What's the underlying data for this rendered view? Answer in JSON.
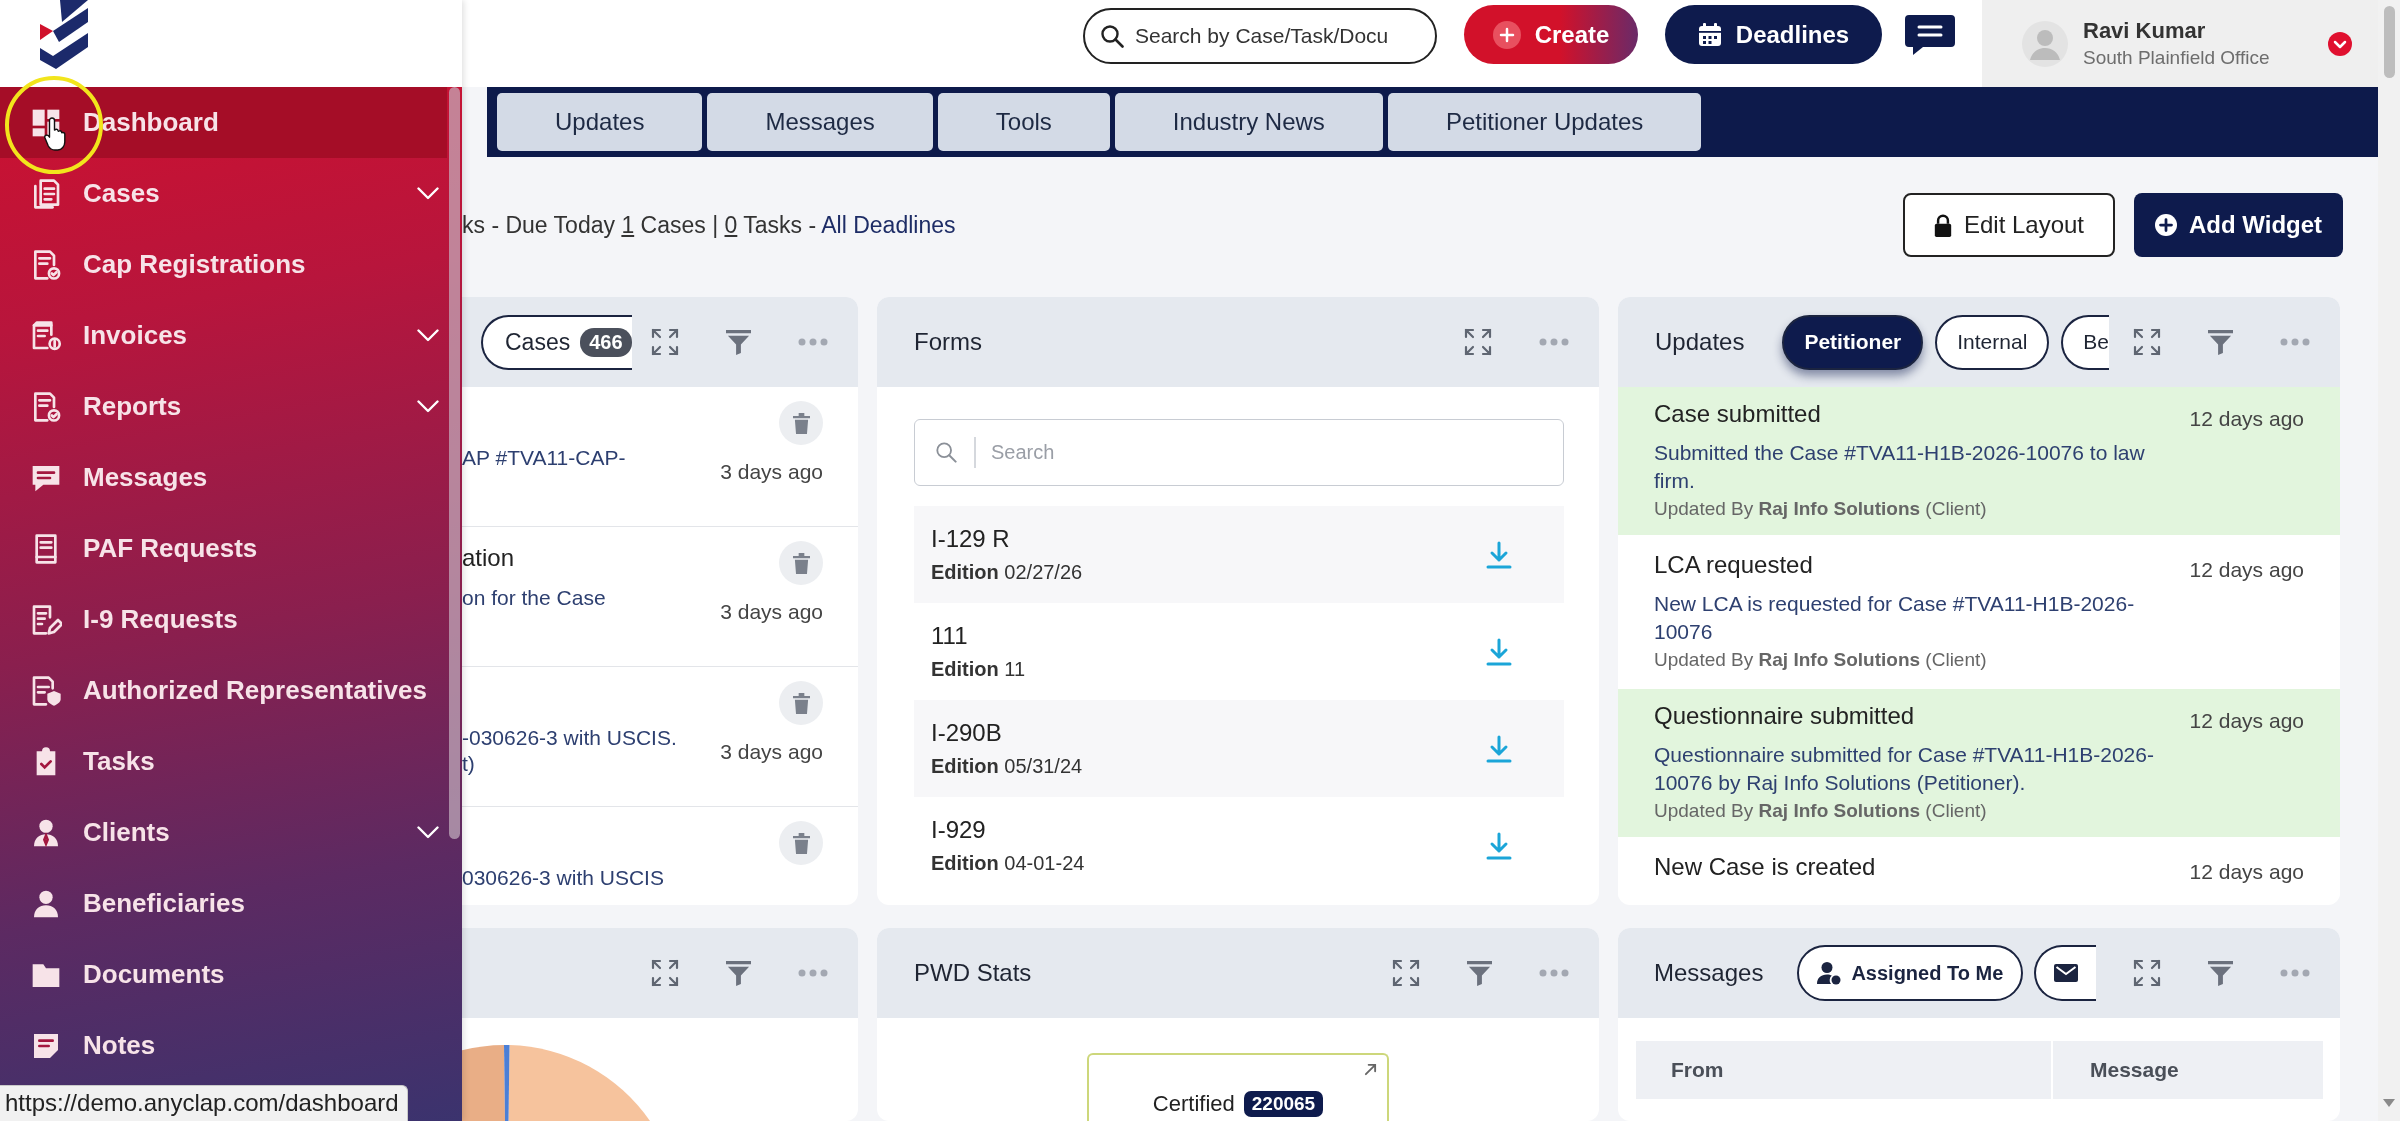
{
  "sidebar": {
    "items": [
      {
        "label": "Dashboard",
        "selected": true,
        "has_submenu": false
      },
      {
        "label": "Cases",
        "selected": false,
        "has_submenu": true
      },
      {
        "label": "Cap Registrations",
        "selected": false,
        "has_submenu": false
      },
      {
        "label": "Invoices",
        "selected": false,
        "has_submenu": true
      },
      {
        "label": "Reports",
        "selected": false,
        "has_submenu": true
      },
      {
        "label": "Messages",
        "selected": false,
        "has_submenu": false
      },
      {
        "label": "PAF Requests",
        "selected": false,
        "has_submenu": false
      },
      {
        "label": "I-9 Requests",
        "selected": false,
        "has_submenu": false
      },
      {
        "label": "Authorized Representatives",
        "selected": false,
        "has_submenu": false
      },
      {
        "label": "Tasks",
        "selected": false,
        "has_submenu": false
      },
      {
        "label": "Clients",
        "selected": false,
        "has_submenu": true
      },
      {
        "label": "Beneficiaries",
        "selected": false,
        "has_submenu": false
      },
      {
        "label": "Documents",
        "selected": false,
        "has_submenu": false
      },
      {
        "label": "Notes",
        "selected": false,
        "has_submenu": false
      }
    ]
  },
  "header": {
    "search": {
      "placeholder": "Search by Case/Task/Docu"
    },
    "create_button": "Create",
    "deadlines_button": "Deadlines",
    "user": {
      "name": "Ravi Kumar",
      "office": "South Plainfield Office"
    }
  },
  "tabs": [
    {
      "label": "Updates",
      "selected": false
    },
    {
      "label": "Messages",
      "selected": false
    },
    {
      "label": "Tools",
      "selected": false
    },
    {
      "label": "Industry News",
      "selected": false
    },
    {
      "label": "Petitioner Updates",
      "selected": false
    }
  ],
  "deadline_summary": {
    "text_1": "ks - Due Today",
    "cases_count": "1",
    "text_2": "Cases |",
    "tasks_count": "0",
    "text_3": "Tasks -",
    "link": "All Deadlines"
  },
  "toolbar": {
    "edit_layout_button": "Edit Layout",
    "add_widget_button": "Add Widget"
  },
  "cases_widget": {
    "filters": [
      {
        "label": "Cases",
        "count": "466",
        "selected": false
      }
    ],
    "items": [
      {
        "lines": [
          "AP #TVA11-CAP-"
        ],
        "time": "3 days ago"
      },
      {
        "title": "ation",
        "lines": [
          "on for the Case"
        ],
        "time": "3 days ago"
      },
      {
        "lines": [
          "-030626-3 with USCIS.",
          "t)"
        ],
        "time": "3 days ago"
      },
      {
        "lines": [
          "030626-3 with USCIS"
        ]
      }
    ]
  },
  "forms_widget": {
    "title": "Forms",
    "search": {
      "placeholder": "Search"
    },
    "items": [
      {
        "name": "I-129 R",
        "edition": "**Edition** 02/27/26"
      },
      {
        "name": "111",
        "edition": "**Edition** 11"
      },
      {
        "name": "I-290B",
        "edition": "**Edition** 05/31/24"
      },
      {
        "name": "I-929",
        "edition": "**Edition** 04-01-24"
      }
    ]
  },
  "updates_widget": {
    "title": "Updates",
    "filters": [
      {
        "label": "Petitioner",
        "selected": true
      },
      {
        "label": "Internal",
        "selected": false
      },
      {
        "label": "Be",
        "selected": false
      }
    ],
    "items": [
      {
        "title": "Case submitted",
        "time": "12 days ago",
        "text": "Submitted the Case #TVA11-H1B-2026-10076 to law firm.",
        "byline": "Updated By **Raj Info Solutions** (Client)",
        "unread": true
      },
      {
        "title": "LCA requested",
        "time": "12 days ago",
        "text": "New LCA is requested for Case #TVA11-H1B-2026-10076",
        "byline": "Updated By **Raj Info Solutions** (Client)",
        "unread": false
      },
      {
        "title": "Questionnaire submitted",
        "time": "12 days ago",
        "text": "Questionnaire submitted for Case #TVA11-H1B-2026-10076 by Raj Info Solutions (Petitioner).",
        "byline": "Updated By **Raj Info Solutions** (Client)",
        "unread": true
      },
      {
        "title": "New Case is created",
        "time": "12 days ago",
        "unread": false
      }
    ]
  },
  "pwd_stats_widget": {
    "title": "PWD Stats",
    "stats": [
      {
        "label": "Certified",
        "count": "220065"
      }
    ]
  },
  "messages_widget": {
    "title": "Messages",
    "filters": [
      {
        "label": "Assigned To Me",
        "selected": false
      }
    ],
    "table": {
      "columns": [
        "From",
        "Message"
      ]
    }
  },
  "status_url": "https://demo.anyclap.com/dashboard"
}
